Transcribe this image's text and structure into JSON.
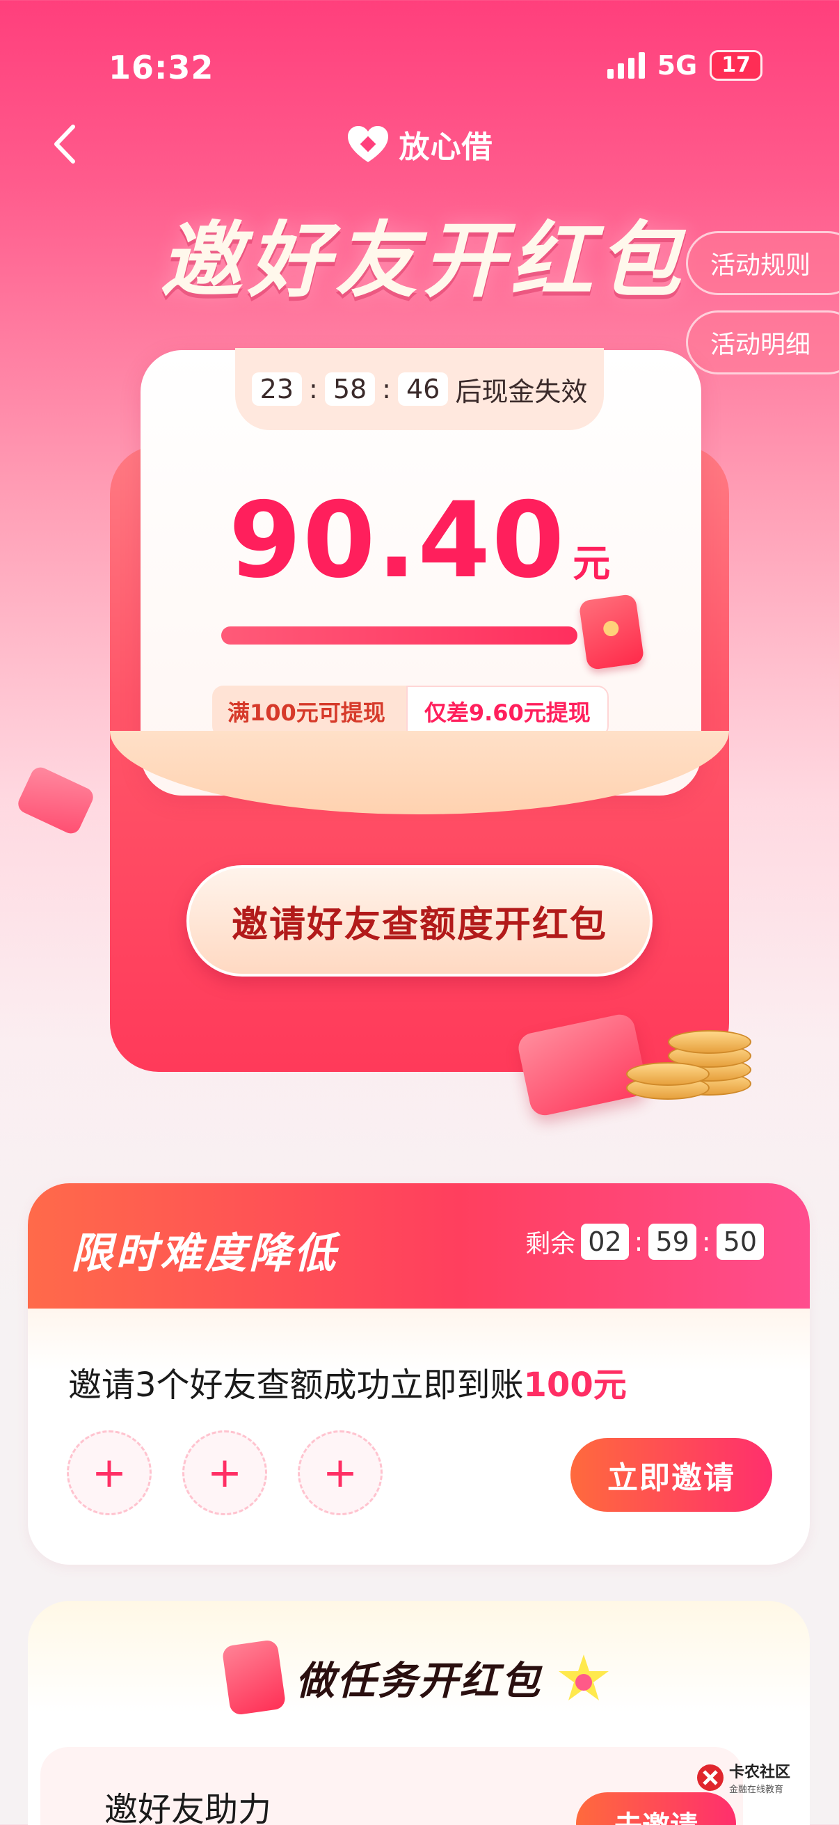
{
  "status_bar": {
    "time": "16:32",
    "network": "5G",
    "battery": "17"
  },
  "nav": {
    "brand_name": "放心借"
  },
  "hero": {
    "headline": "邀好友开红包",
    "rules_label": "活动规则",
    "details_label": "活动明细"
  },
  "envelope": {
    "countdown": {
      "h": "23",
      "m": "58",
      "s": "46",
      "suffix": "后现金失效"
    },
    "amount": "90.40",
    "unit": "元",
    "progress": 0.904,
    "threshold_label": "满100元可提现",
    "gap_label": "仅差9.60元提现",
    "cta_label": "邀请好友查额度开红包"
  },
  "limited": {
    "title": "限时难度降低",
    "remain_label": "剩余",
    "timer": {
      "h": "02",
      "m": "59",
      "s": "50"
    },
    "desc_prefix": "邀请3个好友查额成功立即到账",
    "desc_highlight": "100元",
    "slot_symbol": "+",
    "invite_label": "立即邀请"
  },
  "tasks": {
    "title": "做任务开红包",
    "item_title": "邀好友助力",
    "go_label": "去邀请"
  },
  "watermark": {
    "main": "卡农社区",
    "sub": "金融在线教育"
  },
  "colors": {
    "brand_pink": "#ff1f5c",
    "accent_orange": "#ff6a3d"
  }
}
